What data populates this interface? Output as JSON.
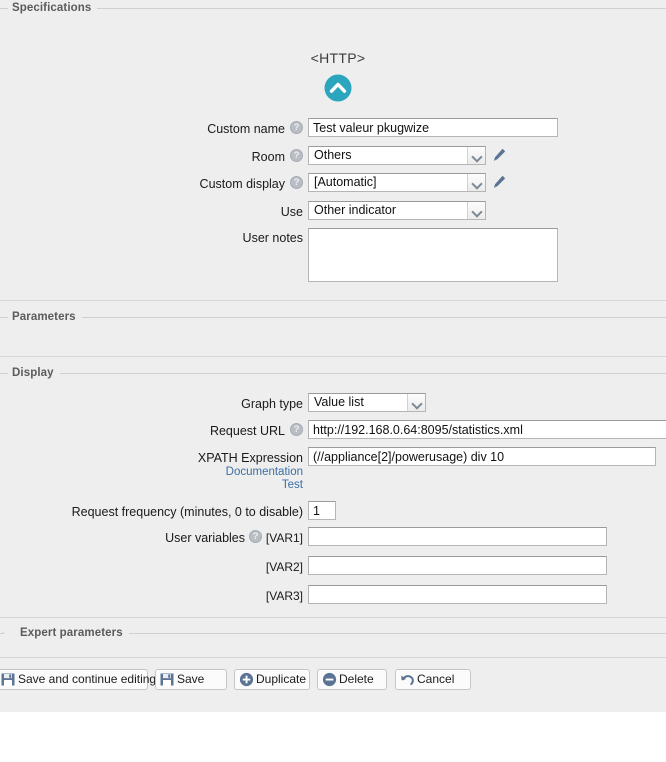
{
  "sections": {
    "specifications": "Specifications",
    "parameters": "Parameters",
    "display": "Display",
    "expert": "Expert parameters"
  },
  "device": {
    "title": "<HTTP>",
    "icon": "chevron-up-circle-icon",
    "icon_color": "#2ba6be"
  },
  "specifications": {
    "custom_name": {
      "label": "Custom name",
      "value": "Test valeur pkugwize",
      "help": "?"
    },
    "room": {
      "label": "Room",
      "value": "Others",
      "help": "?",
      "edit_icon": "pencil-icon"
    },
    "custom_display": {
      "label": "Custom display",
      "value": "[Automatic]",
      "help": "?",
      "edit_icon": "pencil-icon"
    },
    "use": {
      "label": "Use",
      "value": "Other indicator"
    },
    "user_notes": {
      "label": "User notes",
      "value": ""
    }
  },
  "display": {
    "graph_type": {
      "label": "Graph type",
      "value": "Value list"
    },
    "request_url": {
      "label": "Request URL",
      "value": "http://192.168.0.64:8095/statistics.xml",
      "help": "?"
    },
    "xpath": {
      "label": "XPATH Expression",
      "value": "(//appliance[2]/powerusage) div 10",
      "documentation_link": "Documentation",
      "test_link": "Test"
    },
    "request_frequency": {
      "label": "Request frequency (minutes, 0 to disable)",
      "value": "1"
    },
    "user_variables": {
      "label": "User variables",
      "help": "?",
      "rows": [
        {
          "name": "[VAR1]",
          "value": ""
        },
        {
          "name": "[VAR2]",
          "value": ""
        },
        {
          "name": "[VAR3]",
          "value": ""
        }
      ]
    }
  },
  "buttons": [
    {
      "label": "Save and continue editing",
      "icon": "floppy-disk-icon"
    },
    {
      "label": "Save",
      "icon": "floppy-disk-icon"
    },
    {
      "label": "Duplicate",
      "icon": "plus-circle-icon"
    },
    {
      "label": "Delete",
      "icon": "minus-circle-icon"
    },
    {
      "label": "Cancel",
      "icon": "undo-arrow-icon"
    }
  ],
  "colors": {
    "panel_bg": "#eeeeee",
    "link": "#3b6ea5",
    "accent": "#2ba6be",
    "icon_blue": "#5b7494"
  }
}
